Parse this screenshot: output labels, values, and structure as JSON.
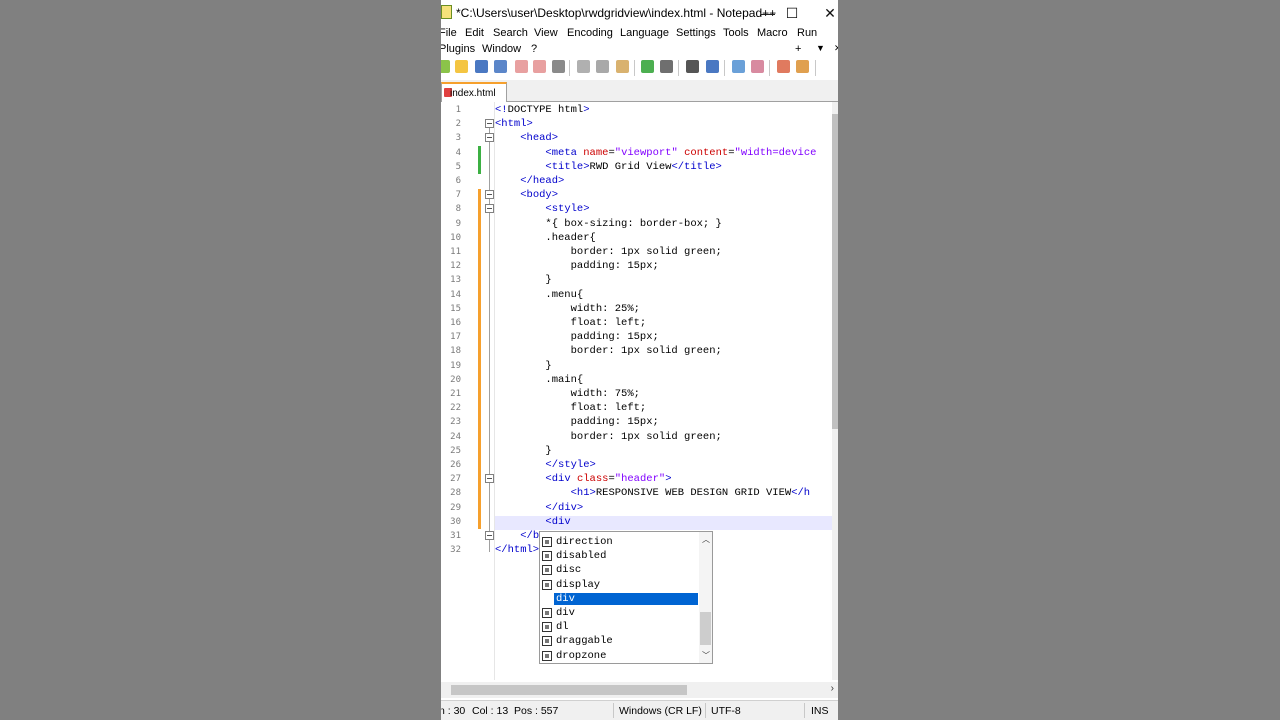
{
  "window": {
    "title": "*C:\\Users\\user\\Desktop\\rwdgridview\\index.html - Notepad++",
    "minimize": "—",
    "maximize": "☐",
    "close": "✕"
  },
  "menu": {
    "row1": [
      "File",
      "Edit",
      "Search",
      "View",
      "Encoding",
      "Language",
      "Settings",
      "Tools",
      "Macro",
      "Run"
    ],
    "row2": [
      "Plugins",
      "Window",
      "?"
    ],
    "extra_plus": "+",
    "extra_down": "▼",
    "extra_close": "✕"
  },
  "tab": {
    "label": "index.html"
  },
  "editor": {
    "line_numbers": [
      "1",
      "2",
      "3",
      "4",
      "5",
      "6",
      "7",
      "8",
      "9",
      "10",
      "11",
      "12",
      "13",
      "14",
      "15",
      "16",
      "17",
      "18",
      "19",
      "20",
      "21",
      "22",
      "23",
      "24",
      "25",
      "26",
      "27",
      "28",
      "29",
      "30",
      "31",
      "32"
    ],
    "lines": [
      [
        {
          "c": "tag",
          "t": "<!"
        },
        {
          "c": "txt",
          "t": "DOCTYPE html"
        },
        {
          "c": "tag",
          "t": ">"
        }
      ],
      [
        {
          "c": "tag",
          "t": "<html>"
        }
      ],
      [
        {
          "c": "txt",
          "t": "    "
        },
        {
          "c": "tag",
          "t": "<head>"
        }
      ],
      [
        {
          "c": "txt",
          "t": "        "
        },
        {
          "c": "tag",
          "t": "<meta "
        },
        {
          "c": "attr",
          "t": "name"
        },
        {
          "c": "txt",
          "t": "="
        },
        {
          "c": "val",
          "t": "\"viewport\""
        },
        {
          "c": "txt",
          "t": " "
        },
        {
          "c": "attr",
          "t": "content"
        },
        {
          "c": "txt",
          "t": "="
        },
        {
          "c": "val",
          "t": "\"width=device"
        }
      ],
      [
        {
          "c": "txt",
          "t": "        "
        },
        {
          "c": "tag",
          "t": "<title>"
        },
        {
          "c": "txt",
          "t": "RWD Grid View"
        },
        {
          "c": "tag",
          "t": "</title>"
        }
      ],
      [
        {
          "c": "txt",
          "t": "    "
        },
        {
          "c": "tag",
          "t": "</head>"
        }
      ],
      [
        {
          "c": "txt",
          "t": "    "
        },
        {
          "c": "tag",
          "t": "<body>"
        }
      ],
      [
        {
          "c": "txt",
          "t": "        "
        },
        {
          "c": "tag",
          "t": "<style>"
        }
      ],
      [
        {
          "c": "txt",
          "t": "        *{ box-sizing: border-box; }"
        }
      ],
      [
        {
          "c": "txt",
          "t": "        .header{"
        }
      ],
      [
        {
          "c": "txt",
          "t": "            border: 1px solid green;"
        }
      ],
      [
        {
          "c": "txt",
          "t": "            padding: 15px;"
        }
      ],
      [
        {
          "c": "txt",
          "t": "        }"
        }
      ],
      [
        {
          "c": "txt",
          "t": "        .menu{"
        }
      ],
      [
        {
          "c": "txt",
          "t": "            width: 25%;"
        }
      ],
      [
        {
          "c": "txt",
          "t": "            float: left;"
        }
      ],
      [
        {
          "c": "txt",
          "t": "            padding: 15px;"
        }
      ],
      [
        {
          "c": "txt",
          "t": "            border: 1px solid green;"
        }
      ],
      [
        {
          "c": "txt",
          "t": "        }"
        }
      ],
      [
        {
          "c": "txt",
          "t": "        .main{"
        }
      ],
      [
        {
          "c": "txt",
          "t": "            width: 75%;"
        }
      ],
      [
        {
          "c": "txt",
          "t": "            float: left;"
        }
      ],
      [
        {
          "c": "txt",
          "t": "            padding: 15px;"
        }
      ],
      [
        {
          "c": "txt",
          "t": "            border: 1px solid green;"
        }
      ],
      [
        {
          "c": "txt",
          "t": "        }"
        }
      ],
      [
        {
          "c": "txt",
          "t": "        "
        },
        {
          "c": "tag",
          "t": "</style>"
        }
      ],
      [
        {
          "c": "txt",
          "t": "        "
        },
        {
          "c": "tag",
          "t": "<div "
        },
        {
          "c": "attr",
          "t": "class"
        },
        {
          "c": "txt",
          "t": "="
        },
        {
          "c": "val",
          "t": "\"header\""
        },
        {
          "c": "tag",
          "t": ">"
        }
      ],
      [
        {
          "c": "txt",
          "t": "            "
        },
        {
          "c": "tag",
          "t": "<h1>"
        },
        {
          "c": "txt",
          "t": "RESPONSIVE WEB DESIGN GRID VIEW"
        },
        {
          "c": "tag",
          "t": "</h"
        }
      ],
      [
        {
          "c": "txt",
          "t": "        "
        },
        {
          "c": "tag",
          "t": "</div>"
        }
      ],
      [
        {
          "c": "txt",
          "t": "        "
        },
        {
          "c": "tag",
          "t": "<div"
        }
      ],
      [
        {
          "c": "txt",
          "t": "    "
        },
        {
          "c": "tag",
          "t": "</b"
        }
      ],
      [
        {
          "c": "tag",
          "t": "</html>"
        }
      ]
    ]
  },
  "autocomplete": {
    "items": [
      "direction",
      "disabled",
      "disc",
      "display",
      "div",
      "div",
      "dl",
      "draggable",
      "dropzone"
    ],
    "selected_index": 4
  },
  "statusbar": {
    "ln": "n : 30",
    "col": "Col : 13",
    "pos": "Pos : 557",
    "eol": "Windows (CR LF)",
    "encoding": "UTF-8",
    "mode": "INS"
  },
  "colors": {
    "accent": "#0064d2",
    "tab_accent": "#f6a02d",
    "tag": "#0000cc",
    "attribute": "#cc0000",
    "value": "#8000ff"
  }
}
